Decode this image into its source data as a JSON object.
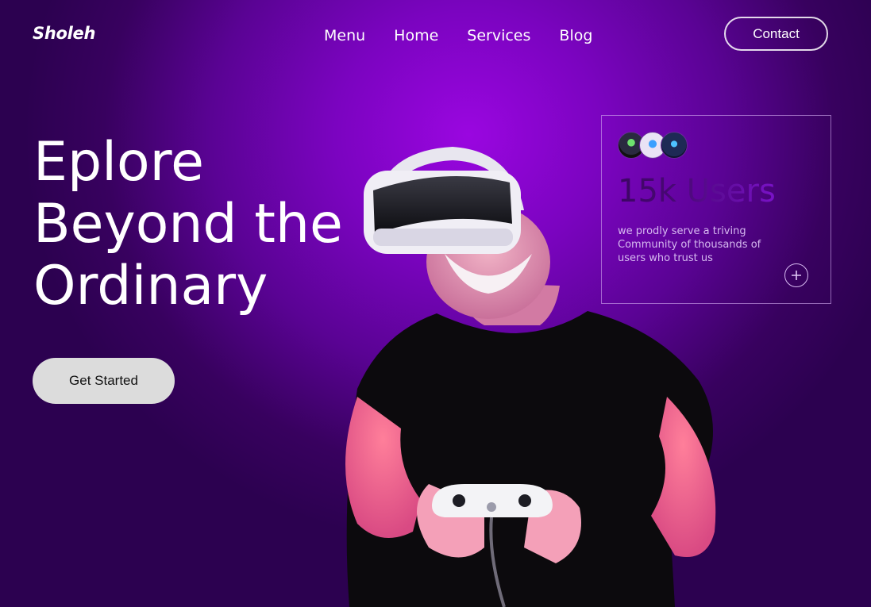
{
  "brand": {
    "logo": "Sholeh"
  },
  "nav": {
    "items": [
      {
        "label": "Menu"
      },
      {
        "label": "Home"
      },
      {
        "label": "Services"
      },
      {
        "label": "Blog"
      }
    ],
    "contact_label": "Contact"
  },
  "hero": {
    "headline_lines": [
      "Eplore",
      "Beyond the",
      "Ordinary"
    ],
    "cta_label": "Get   Started"
  },
  "stats_card": {
    "count": "15k Users",
    "description_lines": [
      "we prodly serve a triving",
      "Community of thousands of",
      "users who trust us"
    ],
    "plus_icon": "plus-circle-icon"
  },
  "colors": {
    "background_glow": "#9a06e0",
    "background_edge": "#2c0150",
    "cta_bg": "#dcdcdc",
    "card_text": "#d6b9f0"
  }
}
